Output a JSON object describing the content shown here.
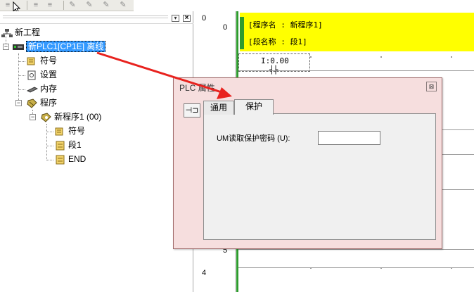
{
  "toolbar": {
    "buttons": [
      "align-left-icon",
      "align-center-icon",
      "tool-a-icon",
      "tool-b-icon",
      "tool-c-icon",
      "tool-d-icon"
    ]
  },
  "tree": {
    "root_label": "新工程",
    "plc_label": "新PLC1[CP1E] 离线",
    "symbols_label": "符号",
    "settings_label": "设置",
    "memory_label": "内存",
    "programs_label": "程序",
    "program1_label": "新程序1 (00)",
    "program1_symbols_label": "符号",
    "section1_label": "段1",
    "end_label": "END"
  },
  "ladder": {
    "rung_numbers": [
      "0",
      "0",
      "5",
      "4"
    ],
    "comment_program": "[程序名 : 新程序1]",
    "comment_section": "[段名称 : 段1]",
    "contact_address": "I:0.00",
    "contact_symbol": "┤├"
  },
  "dialog": {
    "title": "PLC 属性",
    "close_symbol": "⊠",
    "pin_symbol": "⊣⊐",
    "tabs": [
      "通用",
      "保护"
    ],
    "active_tab": "保护",
    "field_label": "UM读取保护密码 (U):",
    "field_value": ""
  },
  "colors": {
    "comment_bg": "#ffff00",
    "rail": "#2e9b2e",
    "selection": "#3399ff",
    "dialog_bg": "#f6dede",
    "arrow": "#e8221e"
  }
}
